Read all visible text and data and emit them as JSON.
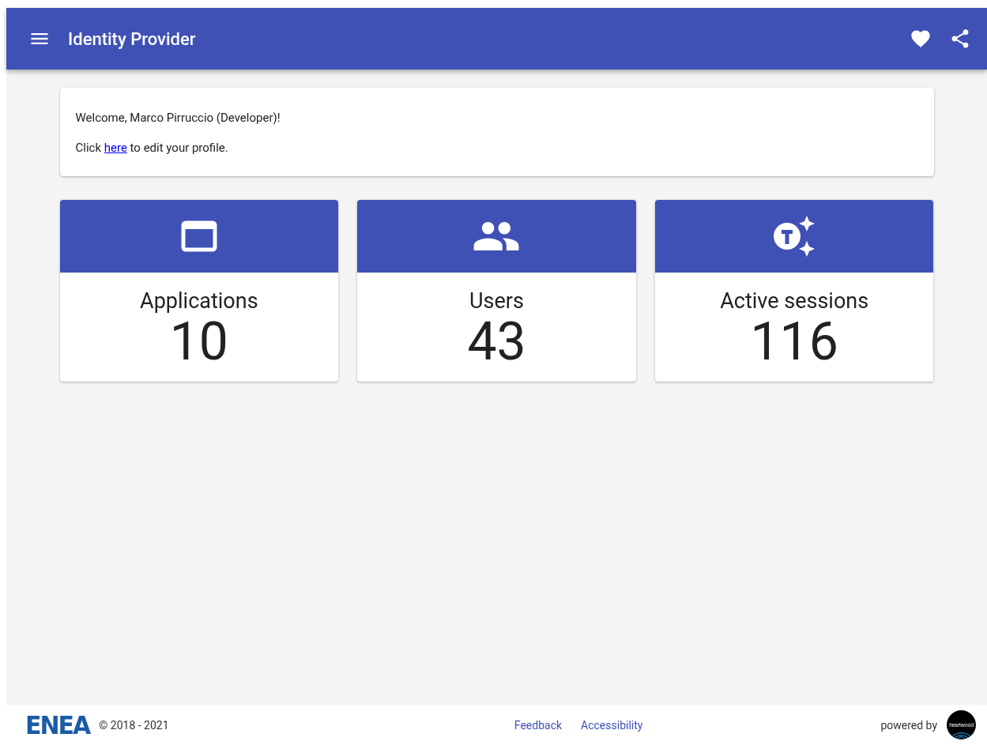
{
  "app_bar": {
    "title": "Identity Provider"
  },
  "welcome": {
    "greeting": "Welcome, Marco Pirruccio (Developer)!",
    "edit_prefix": "Click",
    "edit_link": "here",
    "edit_suffix": "to edit your profile."
  },
  "stats": [
    {
      "kind": "applications",
      "label": "Applications",
      "value": "10"
    },
    {
      "kind": "users",
      "label": "Users",
      "value": "43"
    },
    {
      "kind": "sessions",
      "label": "Active sessions",
      "value": "116"
    }
  ],
  "footer": {
    "logo": "ENEA",
    "copyright": "© 2018 - 2021",
    "links": [
      "Feedback",
      "Accessibility"
    ],
    "powered_by": "powered by",
    "partner_logo": "heartwood"
  }
}
